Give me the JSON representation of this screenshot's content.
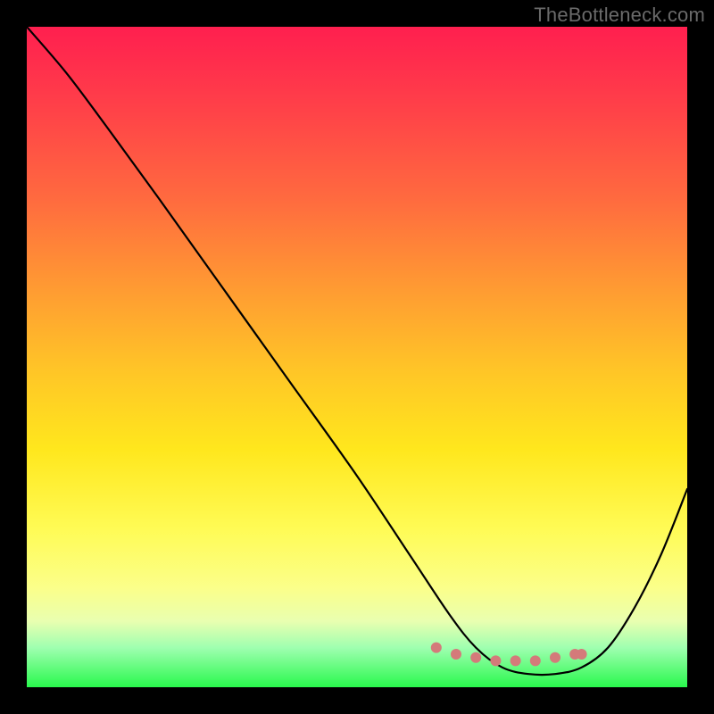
{
  "watermark": "TheBottleneck.com",
  "chart_data": {
    "type": "line",
    "title": "",
    "xlabel": "",
    "ylabel": "",
    "xlim": [
      0,
      100
    ],
    "ylim": [
      0,
      100
    ],
    "series": [
      {
        "name": "curve",
        "x": [
          0,
          6,
          12,
          20,
          30,
          40,
          50,
          58,
          64,
          68,
          72,
          76,
          80,
          84,
          88,
          92,
          96,
          100
        ],
        "values": [
          100,
          93,
          85,
          74,
          60,
          46,
          32,
          20,
          11,
          6,
          3,
          2,
          2,
          3,
          6,
          12,
          20,
          30
        ]
      }
    ],
    "markers": {
      "name": "flat-bottom-dots",
      "x": [
        62,
        65,
        68,
        71,
        74,
        77,
        80,
        83,
        84
      ],
      "values": [
        6,
        5,
        4.5,
        4,
        4,
        4,
        4.5,
        5,
        5
      ],
      "color": "#d47a7a"
    },
    "gradient_stops": [
      {
        "pos": 0,
        "color": "#ff1f4f"
      },
      {
        "pos": 26,
        "color": "#ff6a3f"
      },
      {
        "pos": 52,
        "color": "#ffc527"
      },
      {
        "pos": 76,
        "color": "#fffb55"
      },
      {
        "pos": 100,
        "color": "#29f84d"
      }
    ]
  }
}
